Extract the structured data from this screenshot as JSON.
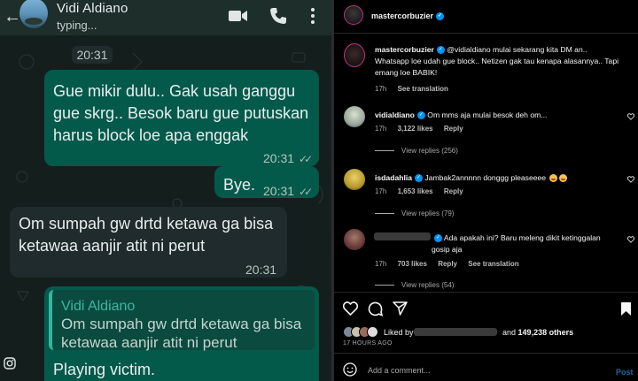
{
  "whatsapp": {
    "contact_name": "Vidi Aldiano",
    "status": "typing...",
    "date_chip": "20:31",
    "messages": [
      {
        "text": "Gue mikir dulu.. Gak usah ganggu gue skrg.. Besok baru gue putuskan harus block loe apa enggak",
        "time": "20:31",
        "ticks": "✓✓"
      },
      {
        "text": "Bye.",
        "time": "20:31",
        "ticks": "✓✓"
      },
      {
        "text": "Om sumpah gw drtd ketawa ga bisa ketawaa aanjir atit ni perut",
        "time": "20:31"
      },
      {
        "quote_name": "Vidi Aldiano",
        "quote_text": "Om sumpah gw drtd ketawa ga bisa ketawaa aanjir atit ni perut",
        "text": "Playing victim."
      }
    ]
  },
  "instagram": {
    "header_username": "mastercorbuzier",
    "caption": {
      "username": "mastercorbuzier",
      "text": "@vidialdiano mulai sekarang kita DM an.. Whatsapp loe udah gue block.. Netizen gak tau kenapa alasannya.. Tapi emang loe BABIK!",
      "time": "17h",
      "see_translation": "See translation"
    },
    "comments": [
      {
        "username": "vidialdiano",
        "text": "Om mms aja mulai besok deh om...",
        "time": "17h",
        "likes": "3,122 likes",
        "reply": "Reply",
        "view_replies": "View replies (256)"
      },
      {
        "username": "isdadahlia",
        "text": "Jambak2annnnn donggg pleaseeee",
        "time": "17h",
        "likes": "1,653 likes",
        "reply": "Reply",
        "view_replies": "View replies (79)"
      },
      {
        "username": "",
        "text": "Ada apakah ini? Baru meleng dikit ketinggalan gosip aja",
        "time": "17h",
        "likes": "703 likes",
        "reply": "Reply",
        "see_translation": "See translation",
        "view_replies": "View replies (54)"
      }
    ],
    "liked_by_prefix": "Liked by",
    "liked_by_suffix_and": "and",
    "liked_by_others": "149,238 others",
    "time_ago": "17 HOURS AGO",
    "add_comment_placeholder": "Add a comment...",
    "post_label": "Post"
  }
}
